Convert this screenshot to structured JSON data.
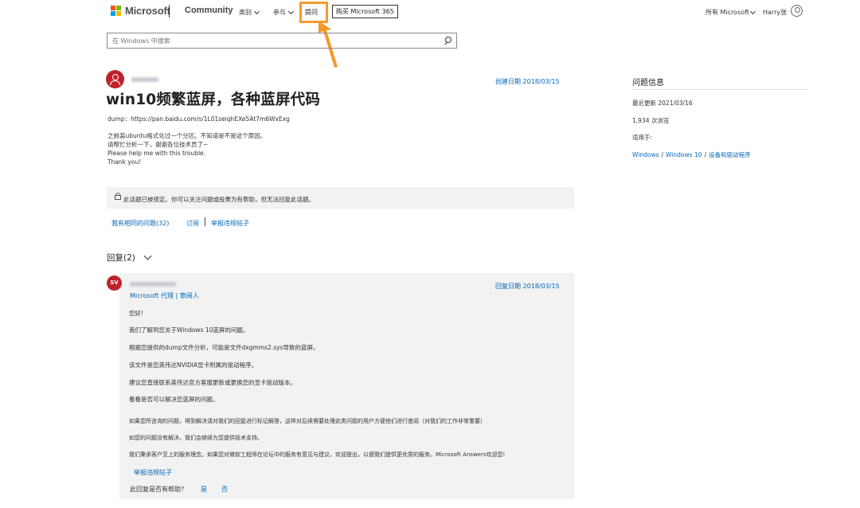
{
  "header": {
    "brand": "Microsoft",
    "site": "Community",
    "nav": [
      "类别",
      "参与"
    ],
    "ask": "提问",
    "buy": "购买 Microsoft 365",
    "all_microsoft": "所有 Microsoft",
    "user": "Harry张",
    "logo_colors": [
      "#f25022",
      "#7fba00",
      "#00a4ef",
      "#ffb900"
    ]
  },
  "search": {
    "placeholder": "在 Windows 中搜索"
  },
  "question": {
    "created": "创建日期 2018/03/15",
    "title": "win10频繁蓝屏，各种蓝屏代码",
    "dump": "dump：https://pan.baidu.com/s/1L01seiqhEXe5At7m6WxExg",
    "body": [
      "之前装ubuntu格式化过一个分区。不知道是不是这个原因。",
      "请帮忙分析一下，谢谢各位技术员了~",
      "Please help me with this trouble.",
      "Thank you!"
    ],
    "locked": "此话题已被锁定。你可以关注问题或投票为有帮助，但无法回复此话题。",
    "same_question": "我有相同的问题(32)",
    "subscribe": "订阅",
    "report": "举报违规帖子"
  },
  "replies": {
    "header": "回复(2)",
    "first": {
      "avatar": "SV",
      "date": "回复日期 2018/03/15",
      "role": "Microsoft 代理 | 审阅人",
      "lines": [
        "您好!",
        "我们了解到您关于Windows 10蓝屏的问题。",
        "根据您提供的dump文件分析，可能是文件dxgmms2.sys导致的蓝屏。",
        "该文件是您英伟达NVIDIA显卡附属的驱动程序。",
        "建议您直接联系英伟达官方客服更新或更换您的显卡驱动版本。",
        "看看是否可以解决您蓝屏的问题。",
        "如果您所咨询的问题，得到解决请对我们的回复进行标记解答，这样对后续需要处理此类问题的用户方便他们进行查阅（对我们的工作非常重要）",
        "如您的问题没有解决，我们会继续为您提供技术支持。",
        "我们秉承客户至上的服务理念。如果您对微软工程师在论坛中的服务有意见与建议，欢迎提出，以便我们提供更优质的服务。Microsoft Answers欢迎您!"
      ],
      "report": "举报违规帖子",
      "helpful": "此回复是否有帮助？",
      "yes": "是",
      "no": "否"
    }
  },
  "info": {
    "title": "问题信息",
    "updated": "最近更新 2021/03/16",
    "views": "1,934 次浏览",
    "applies": "适用于:",
    "crumbs": [
      "Windows",
      "Windows 10",
      "设备和驱动程序"
    ]
  },
  "accent": "#0067b8",
  "highlight": "#f39a2b"
}
